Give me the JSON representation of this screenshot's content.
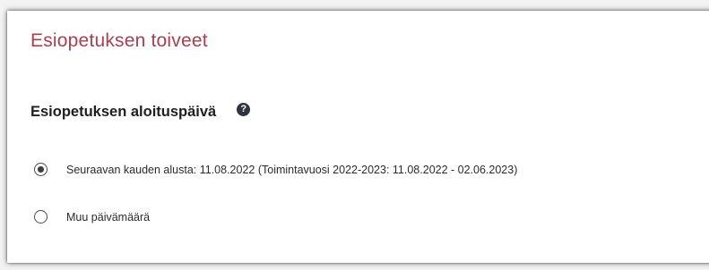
{
  "section": {
    "title": "Esiopetuksen toiveet"
  },
  "start_date": {
    "heading": "Esiopetuksen aloituspäivä",
    "help_icon_glyph": "?",
    "options": [
      {
        "label": "Seuraavan kauden alusta: 11.08.2022 (Toimintavuosi 2022-2023: 11.08.2022 - 02.06.2023)",
        "selected": true
      },
      {
        "label": "Muu päivämäärä",
        "selected": false
      }
    ]
  },
  "colors": {
    "title": "#a8404f",
    "text": "#1f1f1f",
    "help_icon_bg": "#2e3440"
  },
  "icons": [
    "help-icon",
    "radio-checked-icon",
    "radio-unchecked-icon"
  ]
}
